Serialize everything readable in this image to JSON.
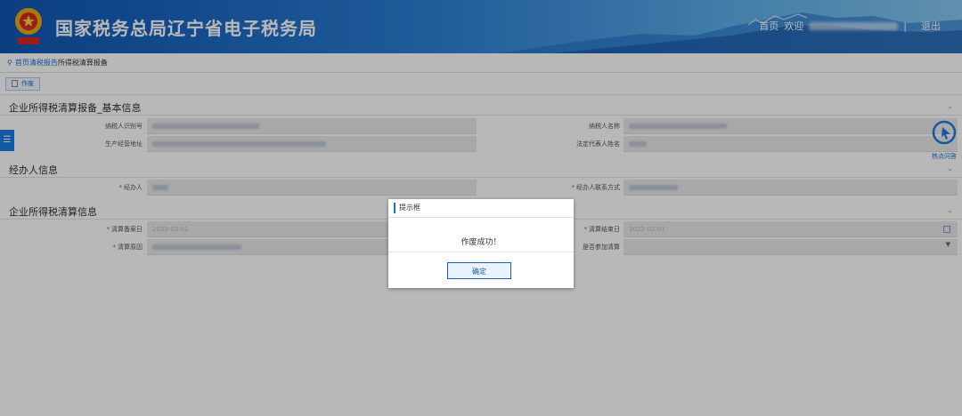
{
  "header": {
    "site_title": "国家税务总局辽宁省电子税务局",
    "home_link": "首页",
    "welcome": "欢迎",
    "logout": "退出"
  },
  "breadcrumb": {
    "home": "首页",
    "middle": "清税报告",
    "current": "所得税清算报备"
  },
  "toolbar": {
    "void_label": "作废"
  },
  "sections": {
    "basic": {
      "title": "企业所得税清算报备_基本信息"
    },
    "agent": {
      "title": "经办人信息"
    },
    "liquidation": {
      "title": "企业所得税清算信息"
    }
  },
  "fields": {
    "taxpayer_id_label": "纳税人识别号",
    "taxpayer_name_label": "纳税人名称",
    "business_address_label": "生产经营地址",
    "legal_rep_label": "法定代表人姓名",
    "agent_label": "经办人",
    "agent_contact_label": "经办人联系方式",
    "start_date_label": "清算备案日",
    "start_date_value": "2022-02-01",
    "end_date_label": "清算结束日",
    "end_date_value": "2022-02-01",
    "reason_label": "清算原因",
    "join_label": "是否参加清算"
  },
  "side": {
    "hotspot_label": "热点问答"
  },
  "modal": {
    "title": "提示框",
    "message": "作废成功！",
    "ok_label": "确定"
  },
  "colors": {
    "primary": "#1a6fd1",
    "header_start": "#0f57b3",
    "header_end": "#86c8f0"
  }
}
